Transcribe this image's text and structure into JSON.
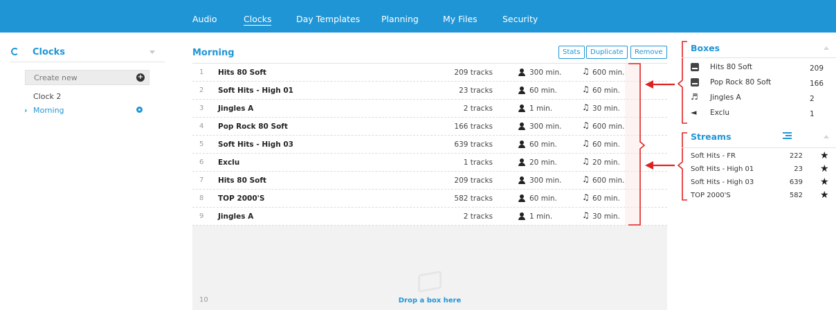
{
  "nav": {
    "items": [
      {
        "label": "Audio",
        "active": false
      },
      {
        "label": "Clocks",
        "active": true
      },
      {
        "label": "Day Templates",
        "active": false
      },
      {
        "label": "Planning",
        "active": false
      },
      {
        "label": "My Files",
        "active": false
      },
      {
        "label": "Security",
        "active": false
      }
    ]
  },
  "left_panel": {
    "title": "Clocks",
    "create_new_label": "Create new",
    "clocks": [
      {
        "label": "Clock 2",
        "active": false
      },
      {
        "label": "Morning",
        "active": true
      }
    ]
  },
  "main": {
    "title": "Morning",
    "buttons": {
      "stats": "Stats",
      "duplicate": "Duplicate",
      "remove": "Remove"
    },
    "rows": [
      {
        "num": "1",
        "name": "Hits 80 Soft",
        "tracks": "209 tracks",
        "duration": "300 min.",
        "max": "600 min."
      },
      {
        "num": "2",
        "name": "Soft Hits - High 01",
        "tracks": "23 tracks",
        "duration": "60 min.",
        "max": "60 min."
      },
      {
        "num": "3",
        "name": "Jingles A",
        "tracks": "2 tracks",
        "duration": "1 min.",
        "max": "30 min."
      },
      {
        "num": "4",
        "name": "Pop Rock 80 Soft",
        "tracks": "166 tracks",
        "duration": "300 min.",
        "max": "600 min."
      },
      {
        "num": "5",
        "name": "Soft Hits - High 03",
        "tracks": "639 tracks",
        "duration": "60 min.",
        "max": "60 min."
      },
      {
        "num": "6",
        "name": "Exclu",
        "tracks": "1 tracks",
        "duration": "20 min.",
        "max": "20 min."
      },
      {
        "num": "7",
        "name": "Hits 80 Soft",
        "tracks": "209 tracks",
        "duration": "300 min.",
        "max": "600 min."
      },
      {
        "num": "8",
        "name": "TOP 2000'S",
        "tracks": "582 tracks",
        "duration": "60 min.",
        "max": "60 min."
      },
      {
        "num": "9",
        "name": "Jingles A",
        "tracks": "2 tracks",
        "duration": "1 min.",
        "max": "30 min."
      }
    ],
    "drop_zone": {
      "num": "10",
      "label": "Drop a box here"
    }
  },
  "boxes": {
    "title": "Boxes",
    "items": [
      {
        "name": "Hits 80 Soft",
        "count": "209",
        "icon": "hdd-icon"
      },
      {
        "name": "Pop Rock 80 Soft",
        "count": "166",
        "icon": "hdd-icon"
      },
      {
        "name": "Jingles A",
        "count": "2",
        "icon": "jingle-icon"
      },
      {
        "name": "Exclu",
        "count": "1",
        "icon": "megaphone-icon"
      }
    ]
  },
  "streams": {
    "title": "Streams",
    "items": [
      {
        "name": "Soft Hits - FR",
        "count": "222"
      },
      {
        "name": "Soft Hits - High 01",
        "count": "23"
      },
      {
        "name": "Soft Hits - High 03",
        "count": "639"
      },
      {
        "name": "TOP 2000'S",
        "count": "582"
      }
    ]
  },
  "colors": {
    "accent": "#1f95d6",
    "annotation": "#e02020"
  }
}
